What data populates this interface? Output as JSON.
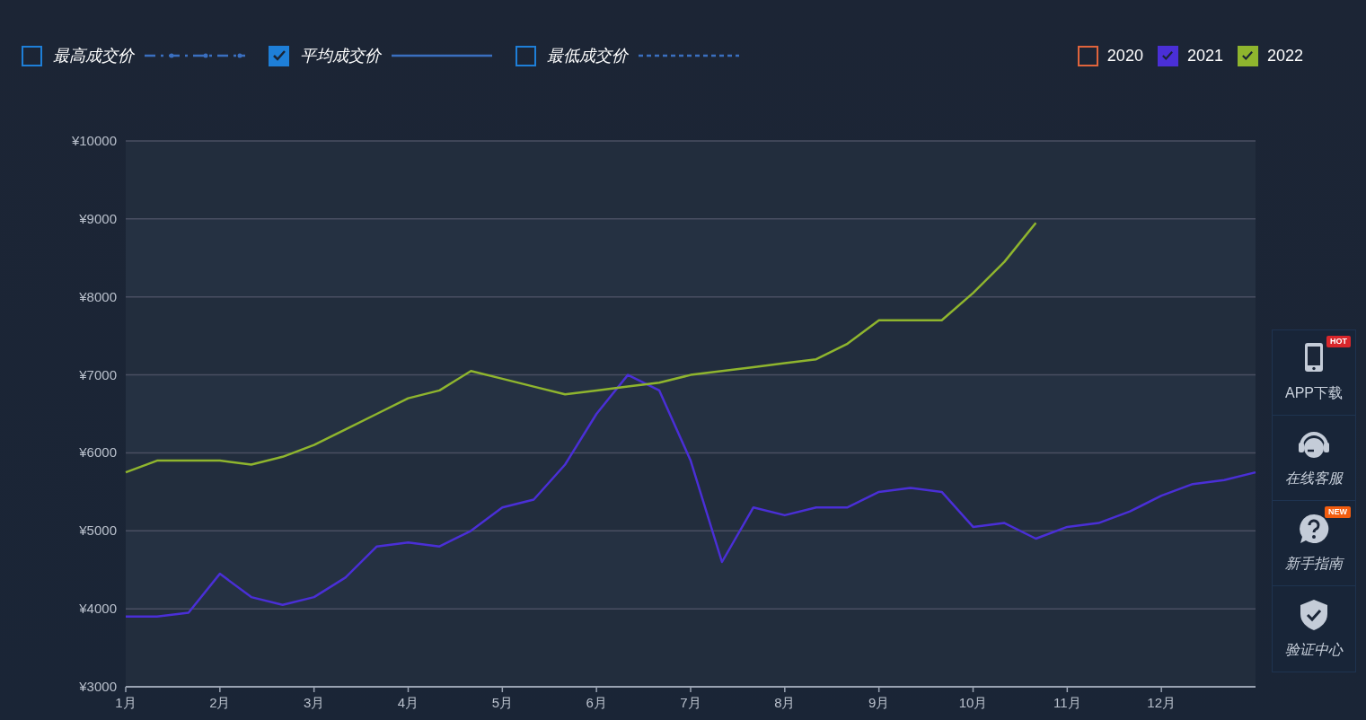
{
  "metric_legend": [
    {
      "label": "最高成交价",
      "checked": false,
      "kind": "dashdot"
    },
    {
      "label": "平均成交价",
      "checked": true,
      "kind": "solid"
    },
    {
      "label": "最低成交价",
      "checked": false,
      "kind": "dashed"
    }
  ],
  "year_legend": [
    {
      "label": "2020",
      "checked": false,
      "color": "#e0643c"
    },
    {
      "label": "2021",
      "checked": true,
      "color": "#4a2fd6"
    },
    {
      "label": "2022",
      "checked": true,
      "color": "#8fb52e"
    }
  ],
  "chart_data": {
    "type": "line",
    "categories": [
      "1月",
      null,
      null,
      "2月",
      null,
      null,
      "3月",
      null,
      null,
      "4月",
      null,
      null,
      "5月",
      null,
      null,
      "6月",
      null,
      null,
      "7月",
      null,
      null,
      "8月",
      null,
      null,
      "9月",
      null,
      null,
      "10月",
      null,
      null,
      "11月",
      null,
      null,
      "12月",
      null,
      null,
      null
    ],
    "series": [
      {
        "color": "#4a2fd6",
        "values": [
          3900,
          3900,
          3950,
          4450,
          4150,
          4050,
          4150,
          4400,
          4800,
          4850,
          4800,
          5000,
          5300,
          5400,
          5850,
          6500,
          7000,
          6800,
          5900,
          4600,
          5300,
          5200,
          5300,
          5300,
          5500,
          5550,
          5500,
          5050,
          5100,
          4900,
          5050,
          5100,
          5250,
          5450,
          5600,
          5650,
          5750
        ]
      },
      {
        "color": "#8fb52e",
        "values": [
          5750,
          5900,
          5900,
          5900,
          5850,
          5950,
          6100,
          6300,
          6500,
          6700,
          6800,
          7050,
          6950,
          6850,
          6750,
          6800,
          6850,
          6900,
          7000,
          7050,
          7100,
          7150,
          7200,
          7400,
          7700,
          7700,
          7700,
          8050,
          8450,
          8950,
          null,
          null,
          null,
          null,
          null,
          null,
          null
        ]
      }
    ],
    "ylim": [
      3000,
      10000
    ],
    "grid": true,
    "yticks": [
      {
        "value": 3000,
        "label": "¥3000"
      },
      {
        "value": 4000,
        "label": "¥4000"
      },
      {
        "value": 5000,
        "label": "¥5000"
      },
      {
        "value": 6000,
        "label": "¥6000"
      },
      {
        "value": 7000,
        "label": "¥7000"
      },
      {
        "value": 8000,
        "label": "¥8000"
      },
      {
        "value": 9000,
        "label": "¥9000"
      },
      {
        "value": 10000,
        "label": "¥10000"
      }
    ]
  },
  "side_panel": [
    {
      "label": "APP下载",
      "kind": "phone",
      "badge": "HOT",
      "color": "#d9262b"
    },
    {
      "label": "在线客服",
      "kind": "headset"
    },
    {
      "label": "新手指南",
      "kind": "help",
      "badge": "NEW",
      "color": "#f25d0f"
    },
    {
      "label": "验证中心",
      "kind": "shield"
    }
  ]
}
